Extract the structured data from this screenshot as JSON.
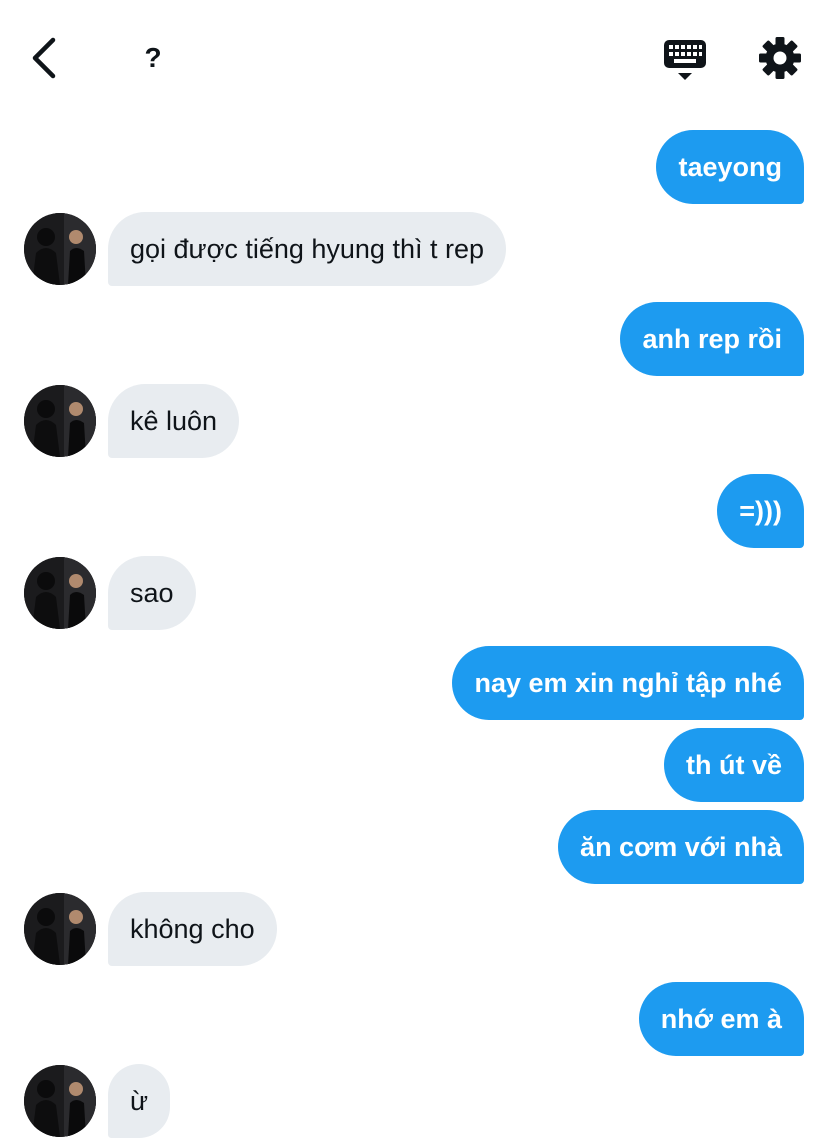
{
  "header": {
    "title": "?",
    "icons": {
      "back": "back-arrow-icon",
      "keyboard": "keyboard-icon",
      "settings": "gear-icon"
    }
  },
  "colors": {
    "sent_bubble": "#1d9bf0",
    "received_bubble": "#e8ecf0",
    "text_dark": "#0f1419"
  },
  "messages": [
    {
      "from": "me",
      "text": "taeyong"
    },
    {
      "from": "them",
      "text": "gọi được tiếng hyung thì t rep"
    },
    {
      "from": "me",
      "text": "anh rep rồi"
    },
    {
      "from": "them",
      "text": "kê luôn"
    },
    {
      "from": "me",
      "text": "=)))"
    },
    {
      "from": "them",
      "text": "sao"
    },
    {
      "from": "me",
      "text": "nay em xin nghỉ tập nhé"
    },
    {
      "from": "me",
      "text": "th út về"
    },
    {
      "from": "me",
      "text": "ăn cơm với nhà"
    },
    {
      "from": "them",
      "text": "không cho"
    },
    {
      "from": "me",
      "text": "nhớ em à"
    },
    {
      "from": "them",
      "text": "ừ"
    }
  ]
}
